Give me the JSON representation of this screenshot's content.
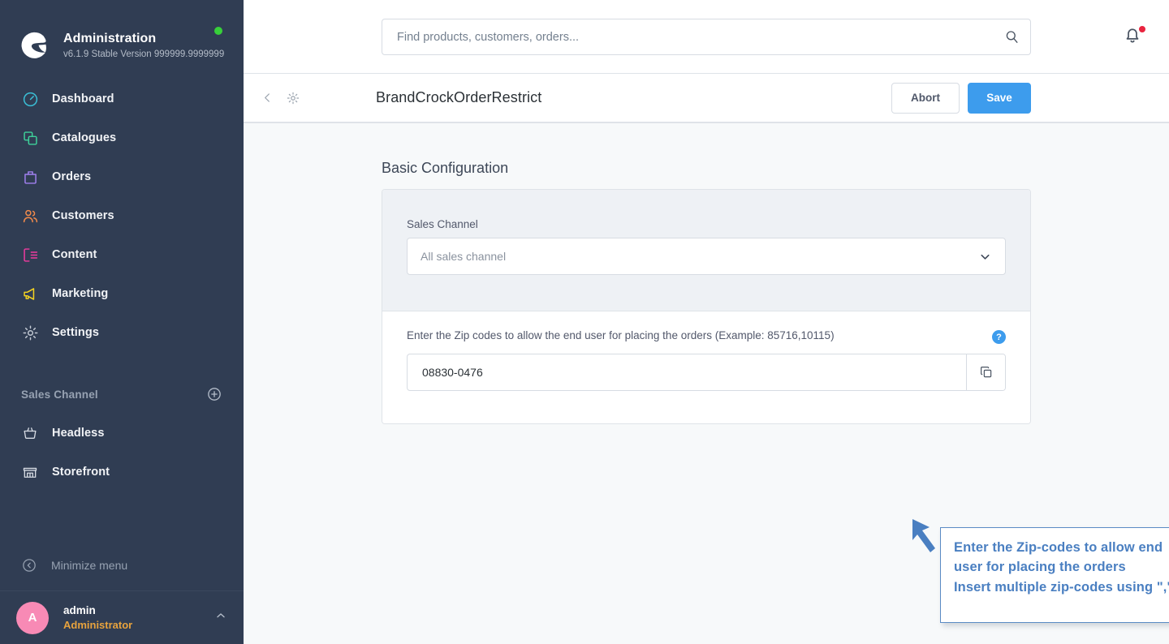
{
  "sidebar": {
    "brand": {
      "logo_icon": "shopware-logo-icon",
      "title": "Administration",
      "version": "v6.1.9 Stable Version 999999.9999999",
      "status_dot_color": "#37d03a"
    },
    "nav_items": [
      {
        "label": "Dashboard",
        "icon": "dashboard-icon",
        "color": "#3bbfd6"
      },
      {
        "label": "Catalogues",
        "icon": "catalogues-icon",
        "color": "#3ed19a"
      },
      {
        "label": "Orders",
        "icon": "orders-icon",
        "color": "#a080ef"
      },
      {
        "label": "Customers",
        "icon": "customers-icon",
        "color": "#f08a4b"
      },
      {
        "label": "Content",
        "icon": "content-icon",
        "color": "#ef3ba0"
      },
      {
        "label": "Marketing",
        "icon": "marketing-icon",
        "color": "#f5d321"
      },
      {
        "label": "Settings",
        "icon": "settings-gear-icon",
        "color": "#c3cad4"
      }
    ],
    "section": {
      "title": "Sales Channel",
      "add_icon": "plus-circle-icon",
      "items": [
        {
          "label": "Headless",
          "icon": "basket-icon"
        },
        {
          "label": "Storefront",
          "icon": "store-icon"
        }
      ]
    },
    "minimize": {
      "label": "Minimize menu",
      "icon": "chevron-left-circle-icon"
    },
    "user": {
      "avatar_initial": "A",
      "avatar_color": "#f88ab5",
      "name": "admin",
      "role": "Administrator",
      "role_color": "#e8a33d",
      "caret_icon": "chevron-up-icon"
    }
  },
  "topbar": {
    "search": {
      "placeholder": "Find products, customers, orders...",
      "value": "",
      "icon": "search-icon"
    },
    "notifications": {
      "icon": "bell-icon",
      "has_unread": true,
      "dot_color": "#e9243f"
    }
  },
  "page_header": {
    "back_icon": "chevron-left-icon",
    "gear_icon": "gear-icon",
    "title": "BrandCrockOrderRestrict",
    "abort_label": "Abort",
    "save_label": "Save",
    "save_color": "#3d9ced"
  },
  "main": {
    "card_title": "Basic Configuration",
    "sales_channel": {
      "label": "Sales Channel",
      "value": "All sales channel",
      "chevron_icon": "chevron-down-icon"
    },
    "zip_field": {
      "label": "Enter the Zip codes to allow the end user for placing the orders (Example: 85716,10115)",
      "help_icon": "question-mark-icon",
      "help_glyph": "?",
      "value": "08830-0476",
      "placeholder": "",
      "copy_icon": "copy-icon"
    }
  },
  "annotation": {
    "arrow_icon": "arrow-up-left-icon",
    "arrow_color": "#4a7fc1",
    "lines": [
      "Enter the Zip-codes to allow end",
      "user for placing the orders",
      "Insert multiple zip-codes using \",\""
    ]
  }
}
